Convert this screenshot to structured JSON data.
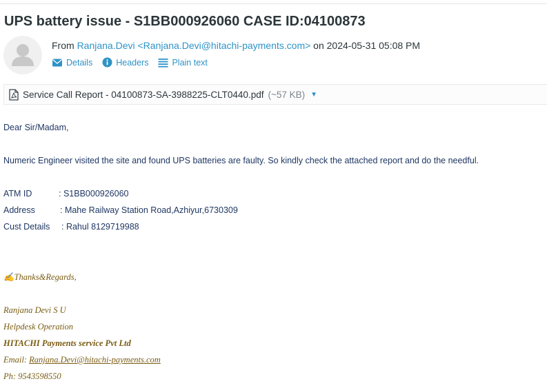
{
  "subject": "UPS battery issue - S1BB000926060 CASE ID:04100873",
  "from": {
    "prefix": "From",
    "sender": "Ranjana.Devi <Ranjana.Devi@hitachi-payments.com>",
    "datetime_text": "on 2024-05-31 05:08 PM"
  },
  "header_links": {
    "details": "Details",
    "headers": "Headers",
    "plain_text": "Plain text"
  },
  "attachment": {
    "filename": "Service Call Report - 04100873-SA-3988225-CLT0440.pdf",
    "size": "(~57 KB)"
  },
  "body": {
    "greeting": "Dear Sir/Madam,",
    "message": "Numeric Engineer visited the site and found UPS batteries are faulty. So kindly check the attached report and do the needful.",
    "fields": [
      {
        "label": "ATM ID",
        "value": ": S1BB000926060"
      },
      {
        "label": "Address",
        "value": ": Mahe Railway Station Road,Azhiyur,6730309"
      },
      {
        "label": "Cust Details",
        "value": ": Rahul 8129719988"
      }
    ]
  },
  "signature": {
    "closing": "✍Thanks&Regards,",
    "name": "Ranjana Devi S U",
    "role": "Helpdesk Operation",
    "company": "HITACHI Payments service Pvt Ltd",
    "email_label": "Email: ",
    "email": "Ranjana.Devi@hitachi-payments.com",
    "phone": "Ph: 9543598550"
  },
  "colors": {
    "link": "#2e93c7",
    "body_text": "#1f3763",
    "signature": "#7a5c12"
  }
}
